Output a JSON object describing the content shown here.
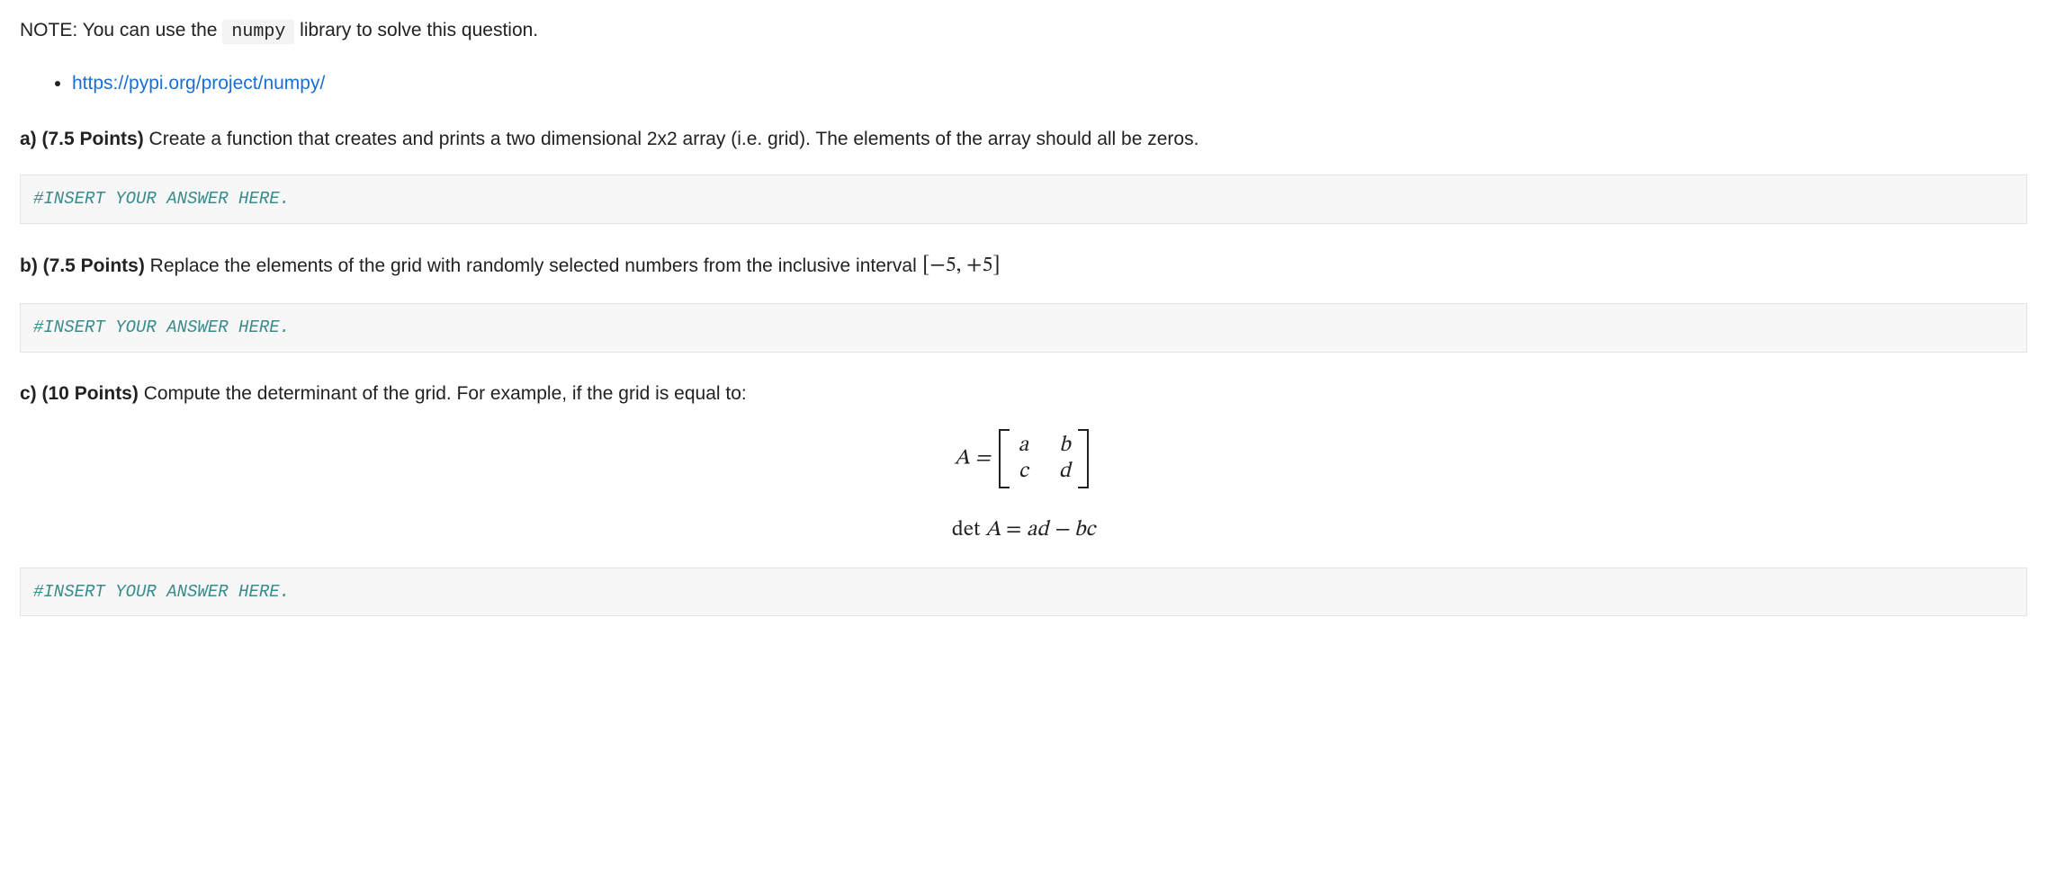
{
  "note": {
    "prefix": "NOTE: You can use the ",
    "code": "numpy",
    "suffix": " library to solve this question."
  },
  "link": {
    "text": "https://pypi.org/project/numpy/",
    "href": "https://pypi.org/project/numpy/"
  },
  "qa": {
    "label": "a) (7.5 Points)",
    "text": " Create a function that creates and prints a two dimensional 2x2 array (i.e. grid). The elements of the array should all be zeros."
  },
  "qb": {
    "label": "b) (7.5 Points)",
    "text_before": " Replace the elements of the grid with randomly selected numbers from the inclusive interval ",
    "interval": "[−5, +5]"
  },
  "qc": {
    "label": "c) (10 Points)",
    "text": " Compute the determinant of the grid. For example, if the grid is equal to:"
  },
  "placeholder": "#INSERT YOUR ANSWER HERE.",
  "matrix": {
    "lhs": "A =",
    "cells": {
      "r0c0": "a",
      "r0c1": "b",
      "r1c0": "c",
      "r1c1": "d"
    }
  },
  "det": {
    "lhs_rm": "det ",
    "lhs_it": "A",
    "eq": " = ",
    "rhs": "ad − bc"
  }
}
